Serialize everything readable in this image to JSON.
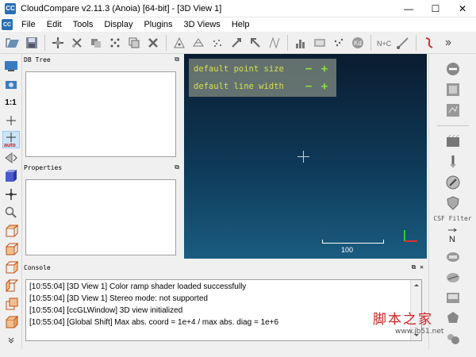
{
  "window": {
    "title": "CloudCompare v2.11.3 (Anoia) [64-bit] - [3D View 1]",
    "minimize": "—",
    "maximize": "☐",
    "close": "✕"
  },
  "menu": {
    "items": [
      "File",
      "Edit",
      "Tools",
      "Display",
      "Plugins",
      "3D Views",
      "Help"
    ]
  },
  "left_tools": {
    "one_to_one": "1:1",
    "auto": "auto"
  },
  "panels": {
    "db_tree": {
      "title": "DB Tree"
    },
    "properties": {
      "title": "Properties"
    },
    "console": {
      "title": "Console"
    }
  },
  "viewport": {
    "point_size_label": "default point size",
    "line_width_label": "default line width",
    "minus": "−",
    "plus": "+",
    "scale_value": "100"
  },
  "right_tools": {
    "csf_filter": "CSF Filter",
    "north": "N"
  },
  "console_lines": [
    "[10:55:04] [3D View 1] Color ramp shader loaded successfully",
    "[10:55:04] [3D View 1] Stereo mode: not supported",
    "[10:55:04] [ccGLWindow] 3D view initialized",
    "[10:55:04] [Global Shift] Max abs. coord = 1e+4 / max abs. diag = 1e+6"
  ],
  "watermark": {
    "brand_cn": "脚本之家",
    "url": "www.jb51.net"
  },
  "colors": {
    "overlay_text": "#d6e048",
    "overlay_buttons": "#8ce03a",
    "viewport_top": "#0a1c30",
    "viewport_bottom": "#1a5c80"
  }
}
